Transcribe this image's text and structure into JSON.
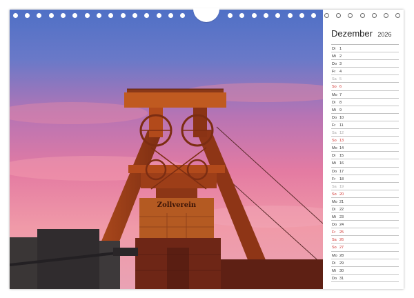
{
  "calendar": {
    "month": "Dezember",
    "year": "2026",
    "days": [
      {
        "wd": "Di",
        "num": "1",
        "type": "weekday"
      },
      {
        "wd": "Mi",
        "num": "2",
        "type": "weekday"
      },
      {
        "wd": "Do",
        "num": "3",
        "type": "weekday"
      },
      {
        "wd": "Fr",
        "num": "4",
        "type": "weekday"
      },
      {
        "wd": "Sa",
        "num": "5",
        "type": "sat"
      },
      {
        "wd": "So",
        "num": "6",
        "type": "sun"
      },
      {
        "wd": "Mo",
        "num": "7",
        "type": "weekday"
      },
      {
        "wd": "Di",
        "num": "8",
        "type": "weekday"
      },
      {
        "wd": "Mi",
        "num": "9",
        "type": "weekday"
      },
      {
        "wd": "Do",
        "num": "10",
        "type": "weekday"
      },
      {
        "wd": "Fr",
        "num": "11",
        "type": "weekday"
      },
      {
        "wd": "Sa",
        "num": "12",
        "type": "sat"
      },
      {
        "wd": "So",
        "num": "13",
        "type": "sun"
      },
      {
        "wd": "Mo",
        "num": "14",
        "type": "weekday"
      },
      {
        "wd": "Di",
        "num": "15",
        "type": "weekday"
      },
      {
        "wd": "Mi",
        "num": "16",
        "type": "weekday"
      },
      {
        "wd": "Do",
        "num": "17",
        "type": "weekday"
      },
      {
        "wd": "Fr",
        "num": "18",
        "type": "weekday"
      },
      {
        "wd": "Sa",
        "num": "19",
        "type": "sat"
      },
      {
        "wd": "So",
        "num": "20",
        "type": "sun"
      },
      {
        "wd": "Mo",
        "num": "21",
        "type": "weekday"
      },
      {
        "wd": "Di",
        "num": "22",
        "type": "weekday"
      },
      {
        "wd": "Mi",
        "num": "23",
        "type": "weekday"
      },
      {
        "wd": "Do",
        "num": "24",
        "type": "weekday"
      },
      {
        "wd": "Fr",
        "num": "25",
        "type": "holiday"
      },
      {
        "wd": "Sa",
        "num": "26",
        "type": "holiday"
      },
      {
        "wd": "So",
        "num": "27",
        "type": "sun"
      },
      {
        "wd": "Mo",
        "num": "28",
        "type": "weekday"
      },
      {
        "wd": "Di",
        "num": "29",
        "type": "weekday"
      },
      {
        "wd": "Mi",
        "num": "30",
        "type": "weekday"
      },
      {
        "wd": "Do",
        "num": "31",
        "type": "weekday"
      }
    ]
  },
  "photo": {
    "sign_text": "Zollverein"
  },
  "binding": {
    "photo_rings": 15,
    "paper_rings": 7
  },
  "colors": {
    "sunday": "#d0312d",
    "saturday": "#a9a9a9",
    "weekday": "#333333"
  }
}
